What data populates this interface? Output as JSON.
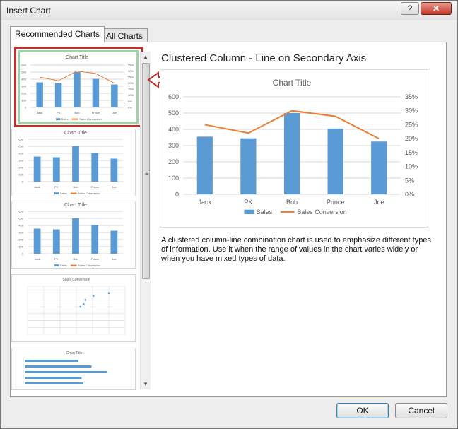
{
  "window": {
    "title": "Insert Chart",
    "help_label": "?",
    "close_label": "✕"
  },
  "tabs": [
    {
      "label": "Recommended Charts"
    },
    {
      "label": "All Charts"
    }
  ],
  "preview": {
    "heading": "Clustered Column - Line on Secondary Axis",
    "description": "A clustered column-line combination chart is used to emphasize different types of information. Use it when the range of values in the chart varies widely or when you have mixed types of data."
  },
  "thumbnails": [
    {
      "title": "Chart Title",
      "legend": "Sales  —  Sales Conversion"
    },
    {
      "title": "Chart Title",
      "legend": "Sales  —  Sales Conversion"
    },
    {
      "title": "Chart Title",
      "legend": "Sales  —  Sales Conversion"
    },
    {
      "title": "Sales Conversion",
      "legend": ""
    },
    {
      "title": "Chart Title",
      "legend": ""
    }
  ],
  "buttons": {
    "ok": "OK",
    "cancel": "Cancel"
  },
  "colors": {
    "bar": "#5b9bd5",
    "line": "#ed7d31",
    "selection": "#c0302c",
    "selection_inner": "#9ed2a9"
  },
  "chart_data": {
    "type": "bar",
    "title": "Chart Title",
    "categories": [
      "Jack",
      "PK",
      "Bob",
      "Prince",
      "Joe"
    ],
    "series": [
      {
        "name": "Sales",
        "type": "bar",
        "axis": "primary",
        "values": [
          355,
          345,
          500,
          405,
          325
        ]
      },
      {
        "name": "Sales Conversion",
        "type": "line",
        "axis": "secondary",
        "values": [
          0.25,
          0.22,
          0.3,
          0.28,
          0.2
        ]
      }
    ],
    "y_ticks": [
      "0",
      "100",
      "200",
      "300",
      "400",
      "500",
      "600"
    ],
    "y2_ticks": [
      "0%",
      "5%",
      "10%",
      "15%",
      "20%",
      "25%",
      "30%",
      "35%"
    ],
    "ylim": [
      0,
      600
    ],
    "y2lim": [
      0,
      0.35
    ],
    "legend_position": "bottom",
    "grid": true
  }
}
